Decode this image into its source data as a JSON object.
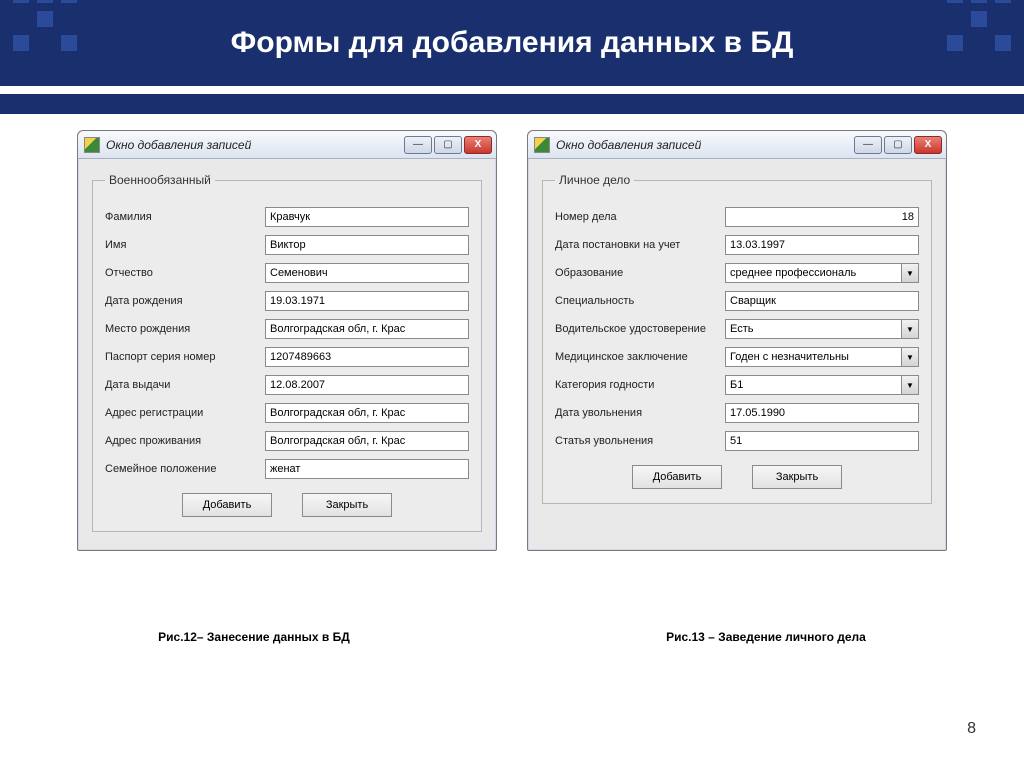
{
  "slide": {
    "title": "Формы для добавления данных в БД",
    "page_number": "8",
    "caption_left": "Рис.12– Занесение  данных в БД",
    "caption_right": "Рис.13 – Заведение личного дела"
  },
  "window_a": {
    "title": "Окно добавления записей",
    "group_title": "Военнообязанный",
    "fields": {
      "surname_label": "Фамилия",
      "surname_value": "Кравчук",
      "name_label": "Имя",
      "name_value": "Виктор",
      "patronymic_label": "Отчество",
      "patronymic_value": "Семенович",
      "birthdate_label": "Дата рождения",
      "birthdate_value": "19.03.1971",
      "birthplace_label": "Место рождения",
      "birthplace_value": "Волгоградская обл, г. Крас",
      "passport_label": "Паспорт серия номер",
      "passport_value": "1207489663",
      "issue_date_label": "Дата выдачи",
      "issue_date_value": "12.08.2007",
      "reg_addr_label": "Адрес регистрации",
      "reg_addr_value": "Волгоградская обл, г. Крас",
      "live_addr_label": "Адрес проживания",
      "live_addr_value": "Волгоградская обл, г. Крас",
      "marital_label": "Семейное положение",
      "marital_value": "женат"
    },
    "buttons": {
      "add": "Добавить",
      "close": "Закрыть"
    }
  },
  "window_b": {
    "title": "Окно добавления записей",
    "group_title": "Личное дело",
    "fields": {
      "case_no_label": "Номер дела",
      "case_no_value": "18",
      "reg_date_label": "Дата постановки на учет",
      "reg_date_value": "13.03.1997",
      "education_label": "Образование",
      "education_value": "среднее профессиональ",
      "speciality_label": "Специальность",
      "speciality_value": "Сварщик",
      "driver_label": "Водительское удостоверение",
      "driver_value": "Есть",
      "medical_label": "Медицинское заключение",
      "medical_value": "Годен с незначительны",
      "category_label": "Категория годности",
      "category_value": "Б1",
      "discharge_date_label": "Дата увольнения",
      "discharge_date_value": "17.05.1990",
      "discharge_article_label": "Статья увольнения",
      "discharge_article_value": "51"
    },
    "buttons": {
      "add": "Добавить",
      "close": "Закрыть"
    }
  }
}
